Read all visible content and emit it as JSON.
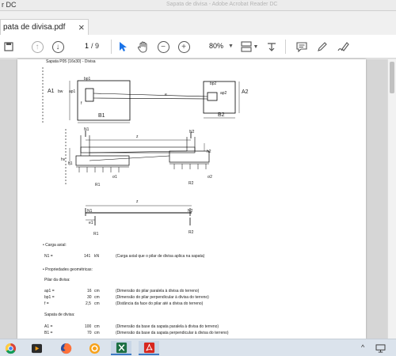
{
  "window": {
    "app_title_fragment": "r DC",
    "doc_title_faded": "Sapata de divisa - Adobe Acrobat Reader DC"
  },
  "tab": {
    "label": "pata de divisa.pdf",
    "close": "×"
  },
  "toolbar": {
    "page_current": "1",
    "page_total": "/ 9",
    "zoom": "80%"
  },
  "document": {
    "heading": "Sapata P05 (16x30) - Divisa",
    "plan": {
      "A1": "A1",
      "A2": "A2",
      "B1": "B1",
      "B2": "B2",
      "bp1": "bp1",
      "ap1": "ap1",
      "bw": "bw",
      "bp2": "bp2",
      "ap2": "ap2",
      "e": "e",
      "f": "f"
    },
    "section": {
      "N1": "N1",
      "N2": "N2",
      "z": "z",
      "hv": "hv",
      "h1": "h1",
      "h2": "h2",
      "R1": "R1",
      "R2": "R2",
      "o1": "σ1",
      "o2": "σ2"
    },
    "beam": {
      "z": "z",
      "N1": "N1",
      "N2": "N2",
      "e1": "e1",
      "R1": "R1",
      "R2": "R2"
    },
    "carga_heading": "• Carga axial:",
    "carga_row": {
      "label": "N1 =",
      "value": "141",
      "unit": "kN",
      "desc": "(Carga axial que o pilar de divisa aplica na sapata)"
    },
    "prop_heading": "• Propriedades geométricas:",
    "pilar_heading": "Pilar da divisa:",
    "pilar_rows": [
      {
        "label": "ap1 =",
        "value": "16",
        "unit": "cm",
        "desc": "(Dimensão do pilar paralela à divisa do terreno)"
      },
      {
        "label": "bp1 =",
        "value": "30",
        "unit": "cm",
        "desc": "(Dimensão do pilar perpendicular à divisa do terreno)"
      },
      {
        "label": "f =",
        "value": "2,5",
        "unit": "cm",
        "desc": "(Distância da face do pilar até a divisa do terreno)"
      }
    ],
    "sapata_heading": "Sapata de divisa:",
    "sapata_rows": [
      {
        "label": "A1 =",
        "value": "100",
        "unit": "cm",
        "desc": "(Dimensão da base da sapata paralela à divisa do terreno)"
      },
      {
        "label": "B1 =",
        "value": "70",
        "unit": "cm",
        "desc": "(Dimensão da base da sapata perpendicular à divisa do terreno)"
      }
    ]
  },
  "taskbar": {
    "tray_chevron": "^"
  },
  "colors": {
    "accent_blue": "#1a73e8",
    "pdf_red": "#d7261e",
    "excel_green": "#1d7044"
  }
}
